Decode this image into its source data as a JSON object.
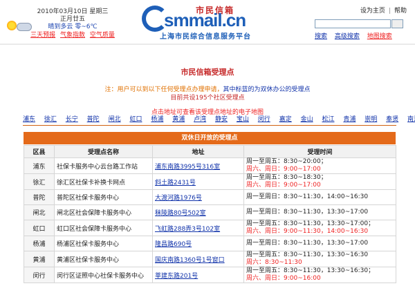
{
  "header": {
    "date": "2010年03月10日  星期三",
    "lunar": "正月廿五",
    "weather": "晴到多云  零~6℃",
    "weather_links": [
      "三天预报",
      "气象指数",
      "空气质量"
    ],
    "logo": {
      "cn_name": "市民信箱",
      "latin": "smmail.cn",
      "subtitle": "上海市民综合信息服务平台"
    },
    "top_links": [
      "设为主页",
      "帮助"
    ],
    "search": {
      "placeholder": "",
      "links": [
        "搜索",
        "高级搜索",
        "地图搜索"
      ]
    }
  },
  "main": {
    "title": "市民信箱受理点",
    "notice_prefix": "注：用户可以到以下任何受理点办理申请，",
    "notice_blue": "其中标蓝的为双休办公的受理点",
    "count": "目前共设195个社区受理点",
    "map_hint": "点击地址可查看该受理点地址的电子地图",
    "districts": [
      "浦东",
      "徐汇",
      "长宁",
      "普陀",
      "闸北",
      "虹口",
      "杨浦",
      "黄浦",
      "卢湾",
      "静安",
      "宝山",
      "闵行",
      "嘉定",
      "金山",
      "松江",
      "青浦",
      "崇明",
      "奉贤",
      "南汇"
    ]
  },
  "table": {
    "banner": "双休日开放的受理点",
    "headers": [
      "区县",
      "受理点名称",
      "地址",
      "受理时间"
    ],
    "rows": [
      {
        "district": "浦东",
        "name": "社保卡服务中心云台路工作站",
        "address": "浦东南路3995号316室",
        "weekday": "周一至周五：8:30~20:00；",
        "weekend": "周六、周日：9:00~17:00"
      },
      {
        "district": "徐汇",
        "name": "徐汇区社保卡补换卡网点",
        "address": "斜土路2431号",
        "weekday": "周一至周五：8:30~18:30；",
        "weekend": "周六、周日：9:00~17:00"
      },
      {
        "district": "普陀",
        "name": "普陀区社保卡服务中心",
        "address": "大渡河路1976号",
        "weekday": "周一至周日：8:30~11:30，14:00~16:30",
        "weekend": ""
      },
      {
        "district": "闸北",
        "name": "闸北区社会保障卡服务中心",
        "address": "秣陵路80号502室",
        "weekday": "周一至周日：8:30~11:30，13:30~17:00",
        "weekend": ""
      },
      {
        "district": "虹口",
        "name": "虹口区社会保障卡服务中心",
        "address": "飞虹路288弄3号102室",
        "weekday": "周一至周五：8:30~11:30，13:30~17:00；",
        "weekend": "周六、周日：9:00~11:30，14:00~16:30"
      },
      {
        "district": "杨浦",
        "name": "杨浦区社保卡服务中心",
        "address": "隆昌路690号",
        "weekday": "周一至周日：8:30~11:30，13:30~17:00",
        "weekend": ""
      },
      {
        "district": "黄浦",
        "name": "黄浦区社保卡服务中心",
        "address": "国庆南路1360号1号窗口",
        "weekday": "周一至周五：8:30~11:30，13:30~16:30",
        "weekend": "周六：8:30~11:30"
      },
      {
        "district": "闵行",
        "name": "闵行区证照中心社保卡服务中心",
        "address": "莘建东路201号",
        "weekday": "周一至周五：8:30~11:30，13:30~16:30；",
        "weekend": "周六、周日：9:00~16:00"
      }
    ]
  },
  "colors": {
    "accent_orange": "#e46a1a",
    "title_red": "#c62828",
    "link_blue": "#1133aa",
    "brand_blue": "#1e5fb8"
  }
}
